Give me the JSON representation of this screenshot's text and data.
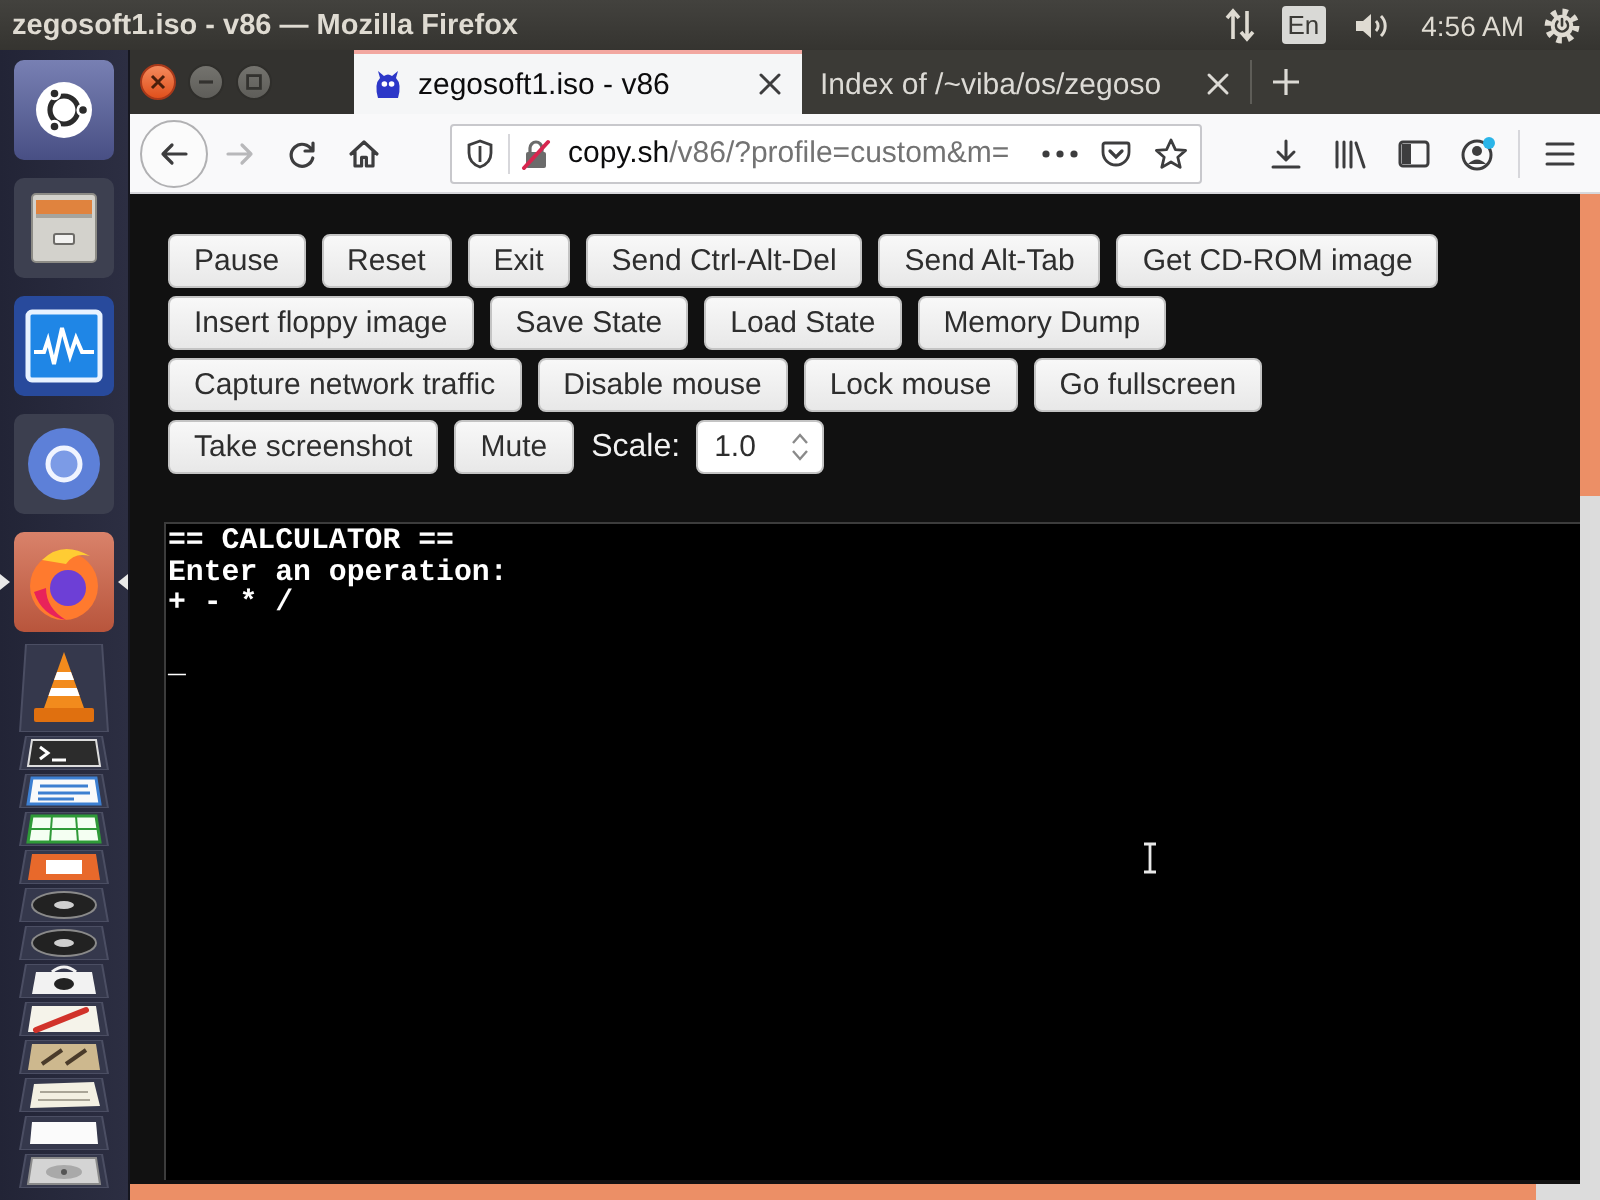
{
  "top_panel": {
    "title": "zegosoft1.iso - v86 — Mozilla Firefox",
    "keyboard_layout": "En",
    "clock": "4:56 AM"
  },
  "launcher": {
    "apps": [
      {
        "kind": "dash",
        "running": false,
        "focused": false
      },
      {
        "kind": "files",
        "running": false,
        "focused": false
      },
      {
        "kind": "monitor",
        "running": false,
        "focused": false
      },
      {
        "kind": "chromium",
        "running": false,
        "focused": false
      },
      {
        "kind": "firefox",
        "running": true,
        "focused": true
      },
      {
        "kind": "vlc",
        "running": false,
        "focused": false
      },
      {
        "kind": "terminal",
        "running": false,
        "focused": false
      },
      {
        "kind": "writer",
        "running": false,
        "focused": false
      },
      {
        "kind": "calc",
        "running": false,
        "focused": false
      },
      {
        "kind": "impress",
        "running": false,
        "focused": false
      },
      {
        "kind": "disc",
        "running": false,
        "focused": false
      },
      {
        "kind": "disc",
        "running": false,
        "focused": false
      },
      {
        "kind": "bag",
        "running": false,
        "focused": false
      },
      {
        "kind": "editor",
        "running": false,
        "focused": false
      },
      {
        "kind": "tools",
        "running": false,
        "focused": false
      },
      {
        "kind": "paper",
        "running": false,
        "focused": false
      },
      {
        "kind": "card",
        "running": false,
        "focused": false
      },
      {
        "kind": "drive",
        "running": false,
        "focused": false
      }
    ]
  },
  "tabs": [
    {
      "title": "zegosoft1.iso - v86",
      "selected": true,
      "has_icon": true
    },
    {
      "title": "Index of /~viba/os/zegoso",
      "selected": false,
      "has_icon": false
    }
  ],
  "nav_buttons": [
    {
      "kind": "back",
      "disabled": false
    },
    {
      "kind": "forward",
      "disabled": true
    },
    {
      "kind": "reload",
      "disabled": false
    },
    {
      "kind": "home",
      "disabled": false
    }
  ],
  "address_bar": {
    "host": "copy.sh",
    "path": "/v86/?profile=custom&m="
  },
  "toolbar_icons": [
    {
      "kind": "download",
      "notification": false
    },
    {
      "kind": "library",
      "notification": false
    },
    {
      "kind": "sidebar",
      "notification": false
    },
    {
      "kind": "account",
      "notification": true
    },
    {
      "kind": "menu",
      "notification": false
    }
  ],
  "page": {
    "controls": [
      [
        {
          "kind": "button",
          "label": "Pause"
        },
        {
          "kind": "button",
          "label": "Reset"
        },
        {
          "kind": "button",
          "label": "Exit"
        },
        {
          "kind": "button",
          "label": "Send Ctrl-Alt-Del"
        },
        {
          "kind": "button",
          "label": "Send Alt-Tab"
        },
        {
          "kind": "button",
          "label": "Get CD-ROM image"
        }
      ],
      [
        {
          "kind": "button",
          "label": "Insert floppy image"
        },
        {
          "kind": "button",
          "label": "Save State"
        },
        {
          "kind": "button",
          "label": "Load State"
        },
        {
          "kind": "button",
          "label": "Memory Dump"
        }
      ],
      [
        {
          "kind": "button",
          "label": "Capture network traffic"
        },
        {
          "kind": "button",
          "label": "Disable mouse"
        },
        {
          "kind": "button",
          "label": "Lock mouse"
        },
        {
          "kind": "button",
          "label": "Go fullscreen"
        }
      ],
      [
        {
          "kind": "button",
          "label": "Take screenshot"
        },
        {
          "kind": "button",
          "label": "Mute"
        },
        {
          "kind": "label",
          "text": "Scale:"
        },
        {
          "kind": "number",
          "value": "1.0"
        }
      ]
    ],
    "screen": {
      "lines": [
        "== CALCULATOR ==",
        "Enter an operation:",
        "+ - * /"
      ],
      "cursor": "_"
    }
  }
}
